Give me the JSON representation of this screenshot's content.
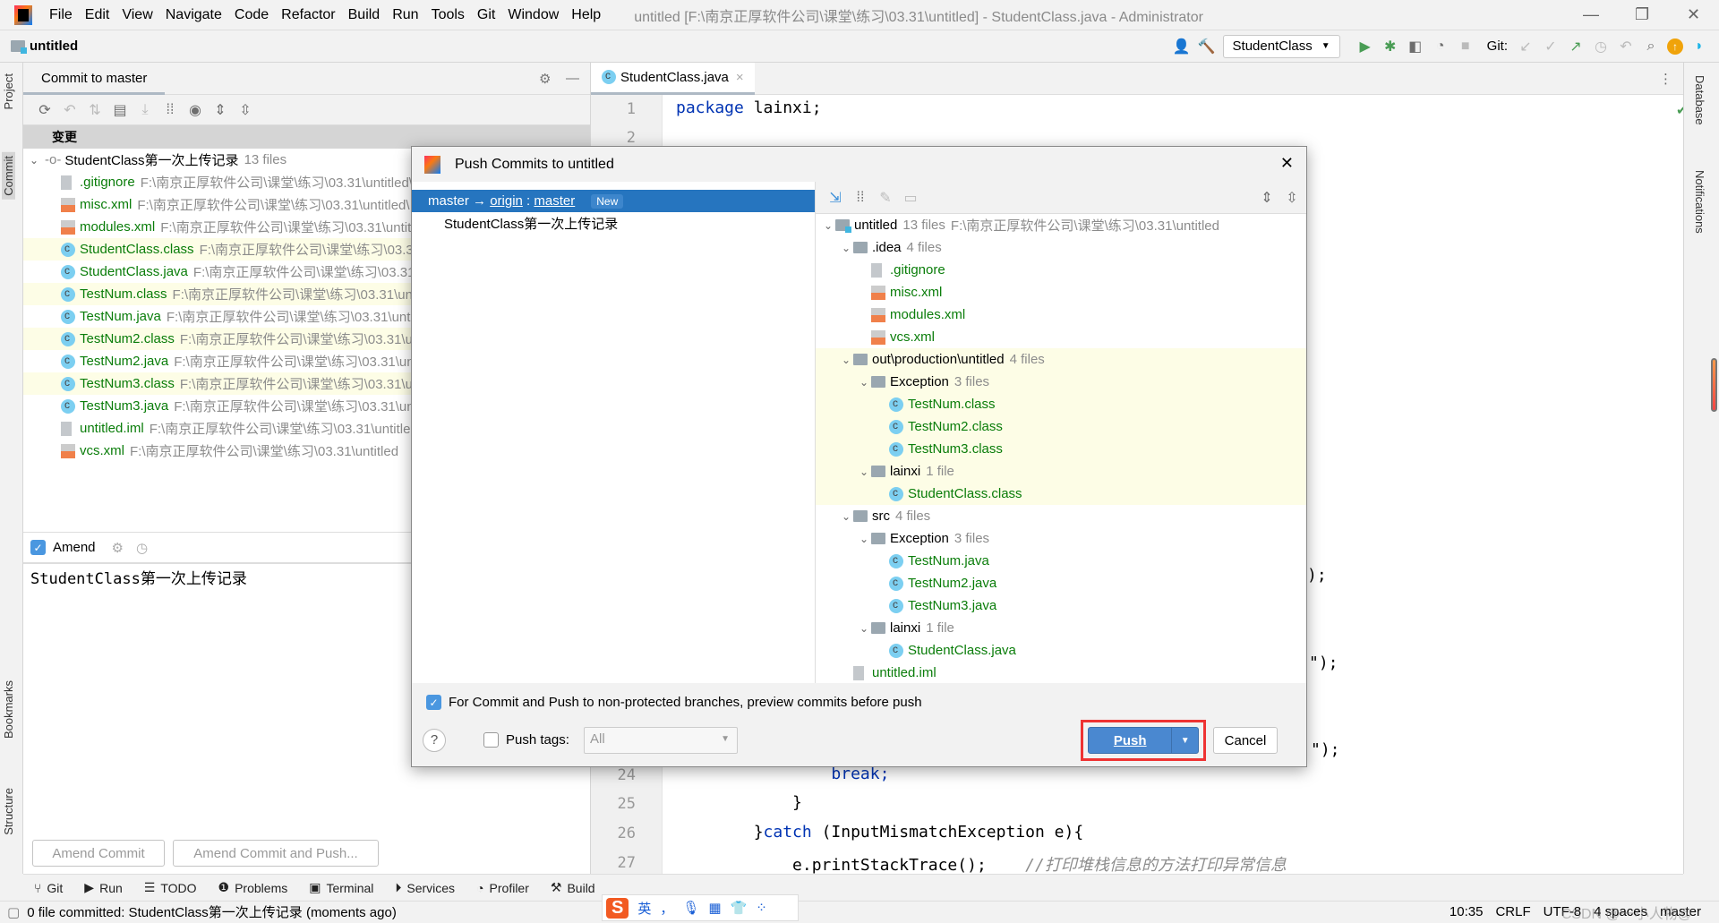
{
  "window": {
    "title": "untitled [F:\\南京正厚软件公司\\课堂\\练习\\03.31\\untitled] - StudentClass.java - Administrator"
  },
  "menu": [
    "File",
    "Edit",
    "View",
    "Navigate",
    "Code",
    "Refactor",
    "Build",
    "Run",
    "Tools",
    "Git",
    "Window",
    "Help"
  ],
  "nav": {
    "project": "untitled",
    "run_config": "StudentClass",
    "git_label": "Git:"
  },
  "left_strip": {
    "project": "Project",
    "commit": "Commit",
    "bookmarks": "Bookmarks",
    "structure": "Structure"
  },
  "right_strip": {
    "database": "Database",
    "notifications": "Notifications"
  },
  "commit_panel": {
    "tab": "Commit to master",
    "group": "变更",
    "commit_name": "StudentClass第一次上传记录",
    "commit_count": "13 files",
    "files": [
      {
        "name": ".gitignore",
        "path": "F:\\南京正厚软件公司\\课堂\\练习\\03.31\\untitled\\.idea",
        "type": "gitignore",
        "hl": false
      },
      {
        "name": "misc.xml",
        "path": "F:\\南京正厚软件公司\\课堂\\练习\\03.31\\untitled\\.idea",
        "type": "xml",
        "hl": false
      },
      {
        "name": "modules.xml",
        "path": "F:\\南京正厚软件公司\\课堂\\练习\\03.31\\untitled\\.idea",
        "type": "xml",
        "hl": false
      },
      {
        "name": "StudentClass.class",
        "path": "F:\\南京正厚软件公司\\课堂\\练习\\03.31\\untitled",
        "type": "class",
        "hl": true
      },
      {
        "name": "StudentClass.java",
        "path": "F:\\南京正厚软件公司\\课堂\\练习\\03.31\\untitled",
        "type": "java",
        "hl": false
      },
      {
        "name": "TestNum.class",
        "path": "F:\\南京正厚软件公司\\课堂\\练习\\03.31\\untitled",
        "type": "class",
        "hl": true
      },
      {
        "name": "TestNum.java",
        "path": "F:\\南京正厚软件公司\\课堂\\练习\\03.31\\untitled",
        "type": "java",
        "hl": false
      },
      {
        "name": "TestNum2.class",
        "path": "F:\\南京正厚软件公司\\课堂\\练习\\03.31\\untitled",
        "type": "class",
        "hl": true
      },
      {
        "name": "TestNum2.java",
        "path": "F:\\南京正厚软件公司\\课堂\\练习\\03.31\\untitled",
        "type": "java",
        "hl": false
      },
      {
        "name": "TestNum3.class",
        "path": "F:\\南京正厚软件公司\\课堂\\练习\\03.31\\untitled",
        "type": "class",
        "hl": true
      },
      {
        "name": "TestNum3.java",
        "path": "F:\\南京正厚软件公司\\课堂\\练习\\03.31\\untitled",
        "type": "java",
        "hl": false
      },
      {
        "name": "untitled.iml",
        "path": "F:\\南京正厚软件公司\\课堂\\练习\\03.31\\untitled",
        "type": "iml",
        "hl": false
      },
      {
        "name": "vcs.xml",
        "path": "F:\\南京正厚软件公司\\课堂\\练习\\03.31\\untitled",
        "type": "xml",
        "hl": false
      }
    ],
    "amend_label": "Amend",
    "amend_checked": true,
    "message": "StudentClass第一次上传记录",
    "amend_commit": "Amend Commit",
    "amend_commit_push": "Amend Commit and Push..."
  },
  "editor": {
    "tab": "StudentClass.java",
    "lines": [
      {
        "n": "1",
        "text": "package lainxi;",
        "kw": "package"
      },
      {
        "n": "2",
        "text": ""
      },
      {
        "n": "24",
        "text": "                break;",
        "kw": "break;"
      },
      {
        "n": "25",
        "text": "            }"
      },
      {
        "n": "26",
        "text": "        }catch (InputMismatchException e){",
        "kw": "catch"
      },
      {
        "n": "27",
        "text": "            e.printStackTrace();",
        "comment": "//打印堆栈信息的方法打印异常信息"
      }
    ],
    "fragments": [
      ");",
      "\");",
      "\");"
    ]
  },
  "dialog": {
    "title": "Push Commits to untitled",
    "branch_from": "master",
    "arrow": "→",
    "remote": "origin",
    "colon": ":",
    "branch_to": "master",
    "badge": "New",
    "commit": "StudentClass第一次上传记录",
    "tree": [
      {
        "d": 0,
        "name": "untitled",
        "count": "13 files",
        "extra": "F:\\南京正厚软件公司\\课堂\\练习\\03.31\\untitled",
        "type": "module",
        "hl": false
      },
      {
        "d": 1,
        "name": ".idea",
        "count": "4 files",
        "type": "folder",
        "hl": false
      },
      {
        "d": 2,
        "name": ".gitignore",
        "type": "gitignore",
        "hl": false
      },
      {
        "d": 2,
        "name": "misc.xml",
        "type": "xml",
        "hl": false
      },
      {
        "d": 2,
        "name": "modules.xml",
        "type": "xml",
        "hl": false
      },
      {
        "d": 2,
        "name": "vcs.xml",
        "type": "xml",
        "hl": false
      },
      {
        "d": 1,
        "name": "out\\production\\untitled",
        "count": "4 files",
        "type": "folder",
        "hl": true
      },
      {
        "d": 2,
        "name": "Exception",
        "count": "3 files",
        "type": "folder",
        "hl": true
      },
      {
        "d": 3,
        "name": "TestNum.class",
        "type": "class",
        "hl": true
      },
      {
        "d": 3,
        "name": "TestNum2.class",
        "type": "class",
        "hl": true
      },
      {
        "d": 3,
        "name": "TestNum3.class",
        "type": "class",
        "hl": true
      },
      {
        "d": 2,
        "name": "lainxi",
        "count": "1 file",
        "type": "folder",
        "hl": true
      },
      {
        "d": 3,
        "name": "StudentClass.class",
        "type": "class",
        "hl": true
      },
      {
        "d": 1,
        "name": "src",
        "count": "4 files",
        "type": "folder",
        "hl": false
      },
      {
        "d": 2,
        "name": "Exception",
        "count": "3 files",
        "type": "folder",
        "hl": false
      },
      {
        "d": 3,
        "name": "TestNum.java",
        "type": "java",
        "hl": false
      },
      {
        "d": 3,
        "name": "TestNum2.java",
        "type": "java",
        "hl": false
      },
      {
        "d": 3,
        "name": "TestNum3.java",
        "type": "java",
        "hl": false
      },
      {
        "d": 2,
        "name": "lainxi",
        "count": "1 file",
        "type": "folder",
        "hl": false
      },
      {
        "d": 3,
        "name": "StudentClass.java",
        "type": "java",
        "hl": false
      },
      {
        "d": 1,
        "name": "untitled.iml",
        "type": "iml",
        "hl": false
      }
    ],
    "preview_label": "For Commit and Push to non-protected branches, preview commits before push",
    "preview_checked": true,
    "help": "?",
    "push_tags_label": "Push tags:",
    "push_tags_checked": false,
    "push_tags_value": "All",
    "push": "Push",
    "cancel": "Cancel"
  },
  "bottom_tools": [
    "Git",
    "Run",
    "TODO",
    "Problems",
    "Terminal",
    "Services",
    "Profiler",
    "Build"
  ],
  "status": {
    "message": "0 file committed: StudentClass第一次上传记录 (moments ago)",
    "position": "10:35",
    "line_sep": "CRLF",
    "encoding": "UTF-8",
    "indent": "4 spaces",
    "branch": "master",
    "watermark": "CSDN @一小人物@"
  },
  "ime": {
    "lang": "英",
    "punct": "，"
  },
  "colors": {
    "selection": "#2675bf",
    "highlight": "#fdfde6",
    "added_file": "#0a7d0a",
    "push_button": "#4a88d0",
    "annotation_box": "#ee3333"
  }
}
